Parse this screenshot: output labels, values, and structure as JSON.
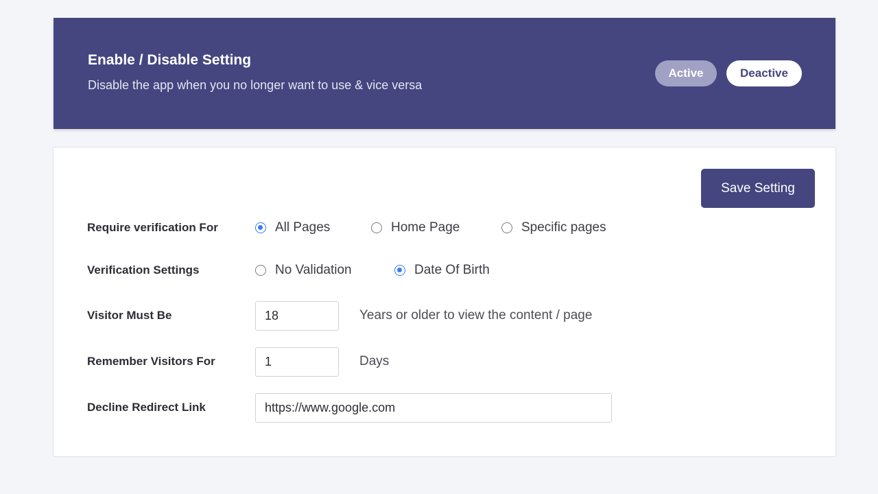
{
  "status_banner": {
    "title": "Enable / Disable Setting",
    "description": "Disable the app when you no longer want to use & vice versa",
    "active_label": "Active",
    "deactive_label": "Deactive"
  },
  "settings": {
    "save_label": "Save Setting",
    "require_verification": {
      "label": "Require verification For",
      "options": [
        "All Pages",
        "Home Page",
        "Specific pages"
      ],
      "selected": "All Pages"
    },
    "verification_settings": {
      "label": "Verification Settings",
      "options": [
        "No Validation",
        "Date Of Birth"
      ],
      "selected": "Date Of Birth"
    },
    "visitor_age": {
      "label": "Visitor Must Be",
      "value": "18",
      "suffix": "Years or older to view the content / page"
    },
    "remember_visitors": {
      "label": "Remember Visitors For",
      "value": "1",
      "suffix": "Days"
    },
    "decline_redirect": {
      "label": "Decline Redirect Link",
      "value": "https://www.google.com"
    }
  },
  "colors": {
    "brand": "#45467f",
    "accent_radio": "#3a7cf2",
    "page_background": "#f4f5f8"
  }
}
